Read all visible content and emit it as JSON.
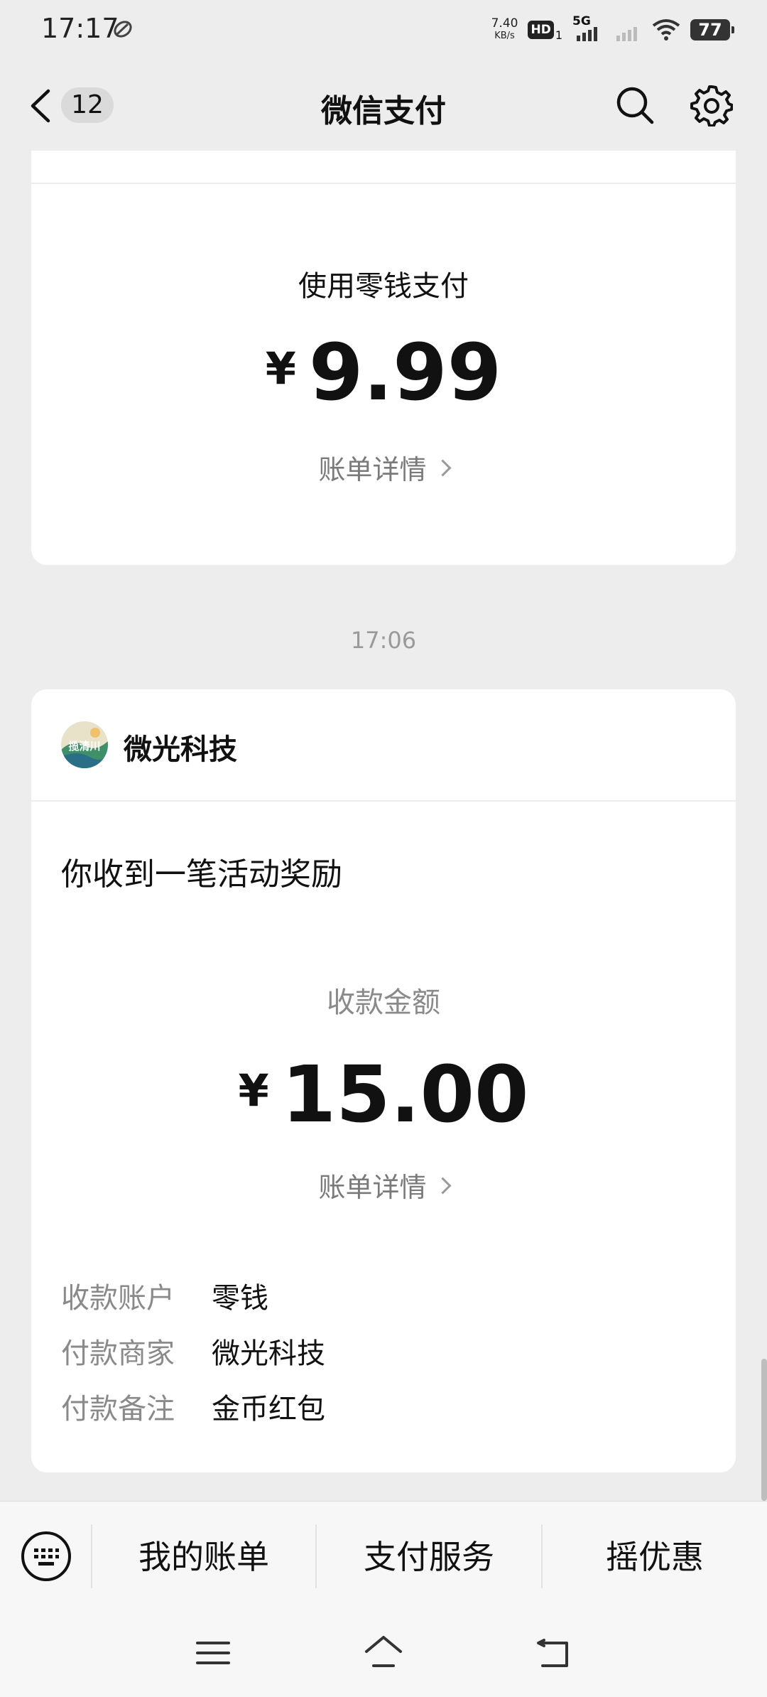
{
  "status_bar": {
    "time": "17:17",
    "net_speed_value": "7.40",
    "net_speed_unit": "KB/s",
    "hd_label": "HD",
    "sim_index": "1",
    "network_type": "5G",
    "battery": "77"
  },
  "nav": {
    "unread_count": "12",
    "title": "微信支付"
  },
  "payment_card": {
    "method": "使用零钱支付",
    "currency": "¥",
    "amount": "9.99",
    "detail_link": "账单详情"
  },
  "timestamp": "17:06",
  "receipt_card": {
    "merchant_name": "微光科技",
    "avatar_text": "揽清川",
    "notice": "你收到一笔活动奖励",
    "amount_label": "收款金额",
    "currency": "¥",
    "amount": "15.00",
    "detail_link": "账单详情",
    "details": [
      {
        "label": "收款账户",
        "value": "零钱"
      },
      {
        "label": "付款商家",
        "value": "微光科技"
      },
      {
        "label": "付款备注",
        "value": "金币红包"
      }
    ]
  },
  "bottom_menu": {
    "items": [
      "我的账单",
      "支付服务",
      "摇优惠"
    ]
  },
  "icons": {
    "back": "back-arrow-icon",
    "search": "search-icon",
    "settings": "gear-icon",
    "keyboard": "keyboard-icon",
    "sys_menu": "menu-lines-icon",
    "sys_home": "home-icon",
    "sys_back": "return-icon"
  }
}
